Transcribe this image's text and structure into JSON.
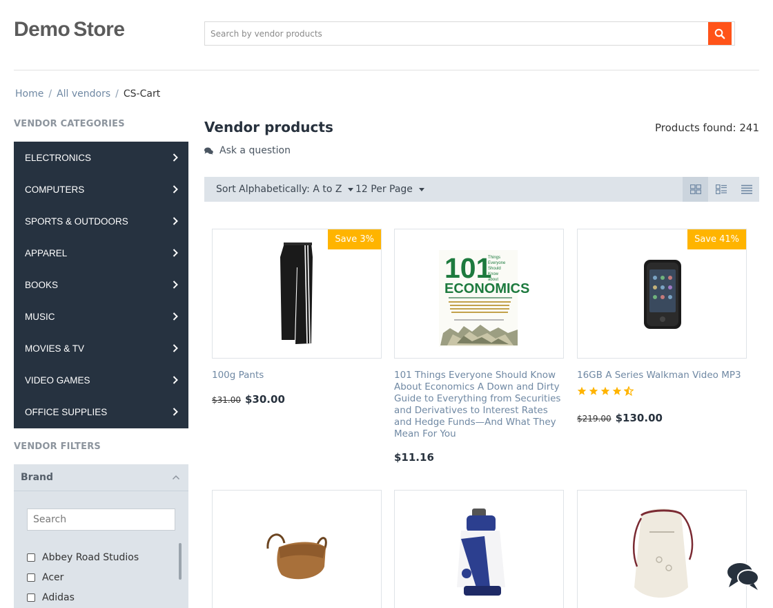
{
  "header": {
    "logo_word1": "Demo",
    "logo_word2": "Store",
    "search_placeholder": "Search by vendor products"
  },
  "breadcrumb": [
    "Home",
    "All vendors",
    "CS-Cart"
  ],
  "sidebar": {
    "categories_title": "VENDOR CATEGORIES",
    "categories": [
      "ELECTRONICS",
      "COMPUTERS",
      "SPORTS & OUTDOORS",
      "APPAREL",
      "BOOKS",
      "MUSIC",
      "MOVIES & TV",
      "VIDEO GAMES",
      "OFFICE SUPPLIES"
    ],
    "filters_title": "VENDOR FILTERS",
    "brand_filter": {
      "title": "Brand",
      "search_placeholder": "Search",
      "options": [
        "Abbey Road Studios",
        "Acer",
        "Adidas"
      ]
    }
  },
  "main": {
    "title": "Vendor products",
    "products_found": "Products found: 241",
    "ask_question": "Ask a question",
    "sort_label": "Sort Alphabetically: A to Z",
    "per_page_label": "12 Per Page"
  },
  "products": [
    {
      "name": "100g Pants",
      "old_price": "$31.00",
      "price": "$30.00",
      "badge": "Save 3%"
    },
    {
      "name": "101 Things Everyone Should Know About Economics A Down and Dirty Guide to Everything from Securities and Derivatives to Interest Rates and Hedge Funds—And What They Mean For You",
      "price": "$11.16",
      "cover": {
        "line1": "101",
        "line2": "ECONOMICS",
        "side": [
          "Things",
          "Everyone",
          "Should",
          "Know",
          "about"
        ]
      }
    },
    {
      "name": "16GB A Series Walkman Video MP3",
      "old_price": "$219.00",
      "price": "$130.00",
      "badge": "Save 41%",
      "rating": 4.5
    }
  ],
  "colors": {
    "accent": "#ff5319",
    "badge": "#ffb400",
    "sidebar_bg": "#263240",
    "link": "#6f88a3",
    "star": "#ffb400"
  }
}
